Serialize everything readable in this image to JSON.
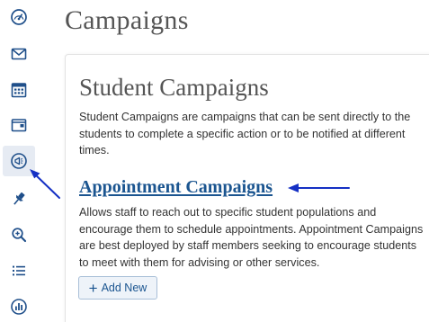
{
  "header": {
    "title": "Campaigns"
  },
  "sidebar": {
    "items": [
      {
        "icon": "dashboard-gauge-icon",
        "active": false
      },
      {
        "icon": "mail-envelope-icon",
        "active": false
      },
      {
        "icon": "calendar-icon",
        "active": false
      },
      {
        "icon": "folder-icon",
        "active": false
      },
      {
        "icon": "megaphone-icon",
        "active": true
      },
      {
        "icon": "pushpin-icon",
        "active": false
      },
      {
        "icon": "search-magnifier-icon",
        "active": false
      },
      {
        "icon": "list-icon",
        "active": false
      },
      {
        "icon": "reports-chart-icon",
        "active": false
      }
    ]
  },
  "main": {
    "section_title": "Student Campaigns",
    "section_description": "Student Campaigns are campaigns that can be sent directly to the students to complete a specific action or to be notified at different times.",
    "campaign": {
      "title": "Appointment Campaigns",
      "description": "Allows staff to reach out to specific student populations and encourage them to schedule appointments. Appointment Campaigns are best deployed by staff members seeking to encourage students to meet with them for advising or other services.",
      "add_label": "Add New"
    }
  },
  "colors": {
    "icon": "#1f4f8a",
    "link": "#1b5590",
    "annotation_arrow": "#1530c4",
    "active_nav_bg": "#e6ebf3"
  }
}
